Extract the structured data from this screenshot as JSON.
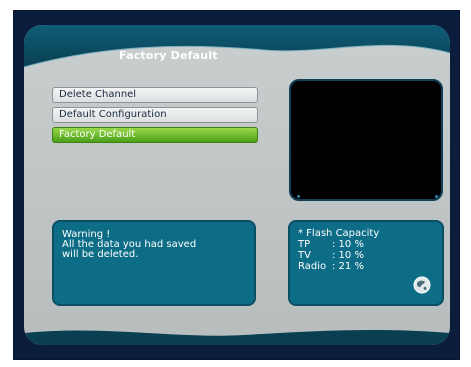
{
  "screen": {
    "title": "Factory Default"
  },
  "menu": {
    "items": [
      {
        "label": "Delete Channel",
        "active": false
      },
      {
        "label": "Default Configuration",
        "active": false
      },
      {
        "label": "Factory Default",
        "active": true
      }
    ]
  },
  "warning": {
    "line1": "Warning !",
    "line2": "All the data you had saved",
    "line3": "will be deleted."
  },
  "flash": {
    "title": "* Flash Capacity",
    "rows": [
      {
        "label": "TP",
        "value": ": 10 %"
      },
      {
        "label": "TV",
        "value": ": 10 %"
      },
      {
        "label": "Radio",
        "value": ": 21 %"
      }
    ]
  },
  "colors": {
    "background": "#0b1d3c",
    "panel": "#c0c6c6",
    "header": "#0e4f66",
    "menu_active": "#6fbe2e",
    "info_box": "#0e6d86"
  },
  "icons": {
    "flash_icon": "globe-icon"
  }
}
